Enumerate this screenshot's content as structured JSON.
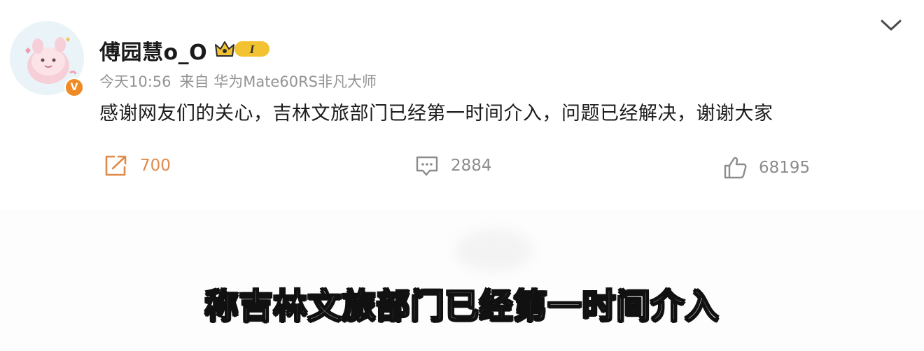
{
  "post": {
    "username": "傅园慧o_O",
    "level_badge": "I",
    "verified_mark": "V",
    "time": "今天10:56",
    "source": "来自 华为Mate60RS非凡大师",
    "content": "感谢网友们的关心，吉林文旅部门已经第一时间介入，问题已经解决，谢谢大家"
  },
  "actions": {
    "repost_count": "700",
    "comment_count": "2884",
    "like_count": "68195"
  },
  "video": {
    "subtitle": "称吉林文旅部门已经第一时间介入"
  },
  "colors": {
    "repost_accent": "#e08a4a",
    "verified_badge": "#f08a24",
    "badge_gold": "#f2c230",
    "meta_gray": "#939393"
  },
  "icons": [
    "avatar-illustration",
    "verified-icon",
    "crown-icon",
    "chevron-down-icon",
    "repost-icon",
    "comment-icon",
    "like-icon"
  ]
}
